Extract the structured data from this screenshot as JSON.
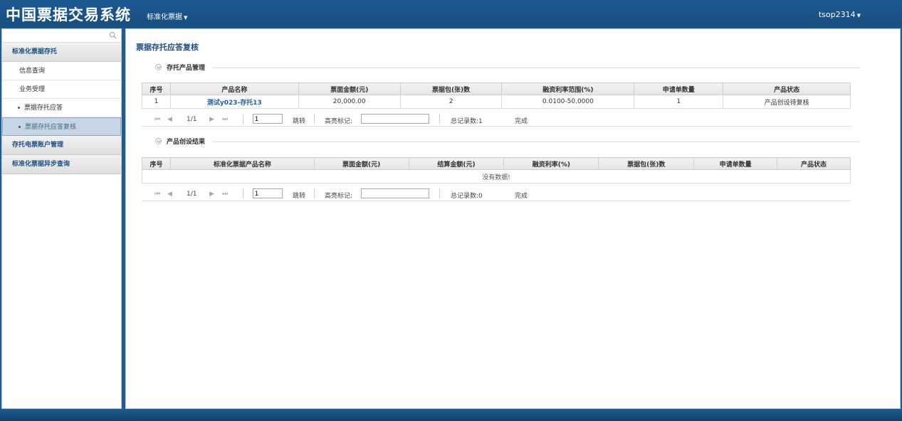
{
  "header": {
    "app_title": "中国票据交易系统",
    "menu_label": "标准化票据",
    "user_label": "tsop2314"
  },
  "sidebar": {
    "search_placeholder": "",
    "groups": [
      {
        "label": "标准化票据存托",
        "items": [
          {
            "label": "信息查询"
          },
          {
            "label": "业务受理"
          },
          {
            "label": "票据存托应答"
          },
          {
            "label": "票据存托应答复核"
          }
        ]
      },
      {
        "label": "存托电票账户管理"
      },
      {
        "label": "标准化票据异步查询"
      }
    ]
  },
  "main": {
    "title": "票据存托应答复核",
    "section1": {
      "legend": "存托产品管理",
      "columns": [
        "序号",
        "产品名称",
        "票面金额(元)",
        "票据包(张)数",
        "融资利率范围(%)",
        "申请单数量",
        "产品状态"
      ],
      "rows": [
        [
          "1",
          "测试y023-存托13",
          "20,000.00",
          "2",
          "0.0100-50.0000",
          "1",
          "产品创设待复核"
        ]
      ],
      "pager": {
        "page_info": "1/1",
        "page_input": "1",
        "jump_label": "跳转",
        "highlight_label": "高亮标记:",
        "total_label": "总记录数:1",
        "status_label": "完成"
      }
    },
    "section2": {
      "legend": "产品创设结果",
      "columns": [
        "序号",
        "标准化票据产品名称",
        "票面金额(元)",
        "结算金额(元)",
        "融资利率(%)",
        "票据包(张)数",
        "申请单数量",
        "产品状态"
      ],
      "empty_text": "没有数据!",
      "pager": {
        "page_info": "1/1",
        "page_input": "1",
        "jump_label": "跳转",
        "highlight_label": "高亮标记:",
        "total_label": "总记录数:0",
        "status_label": "完成"
      }
    }
  }
}
